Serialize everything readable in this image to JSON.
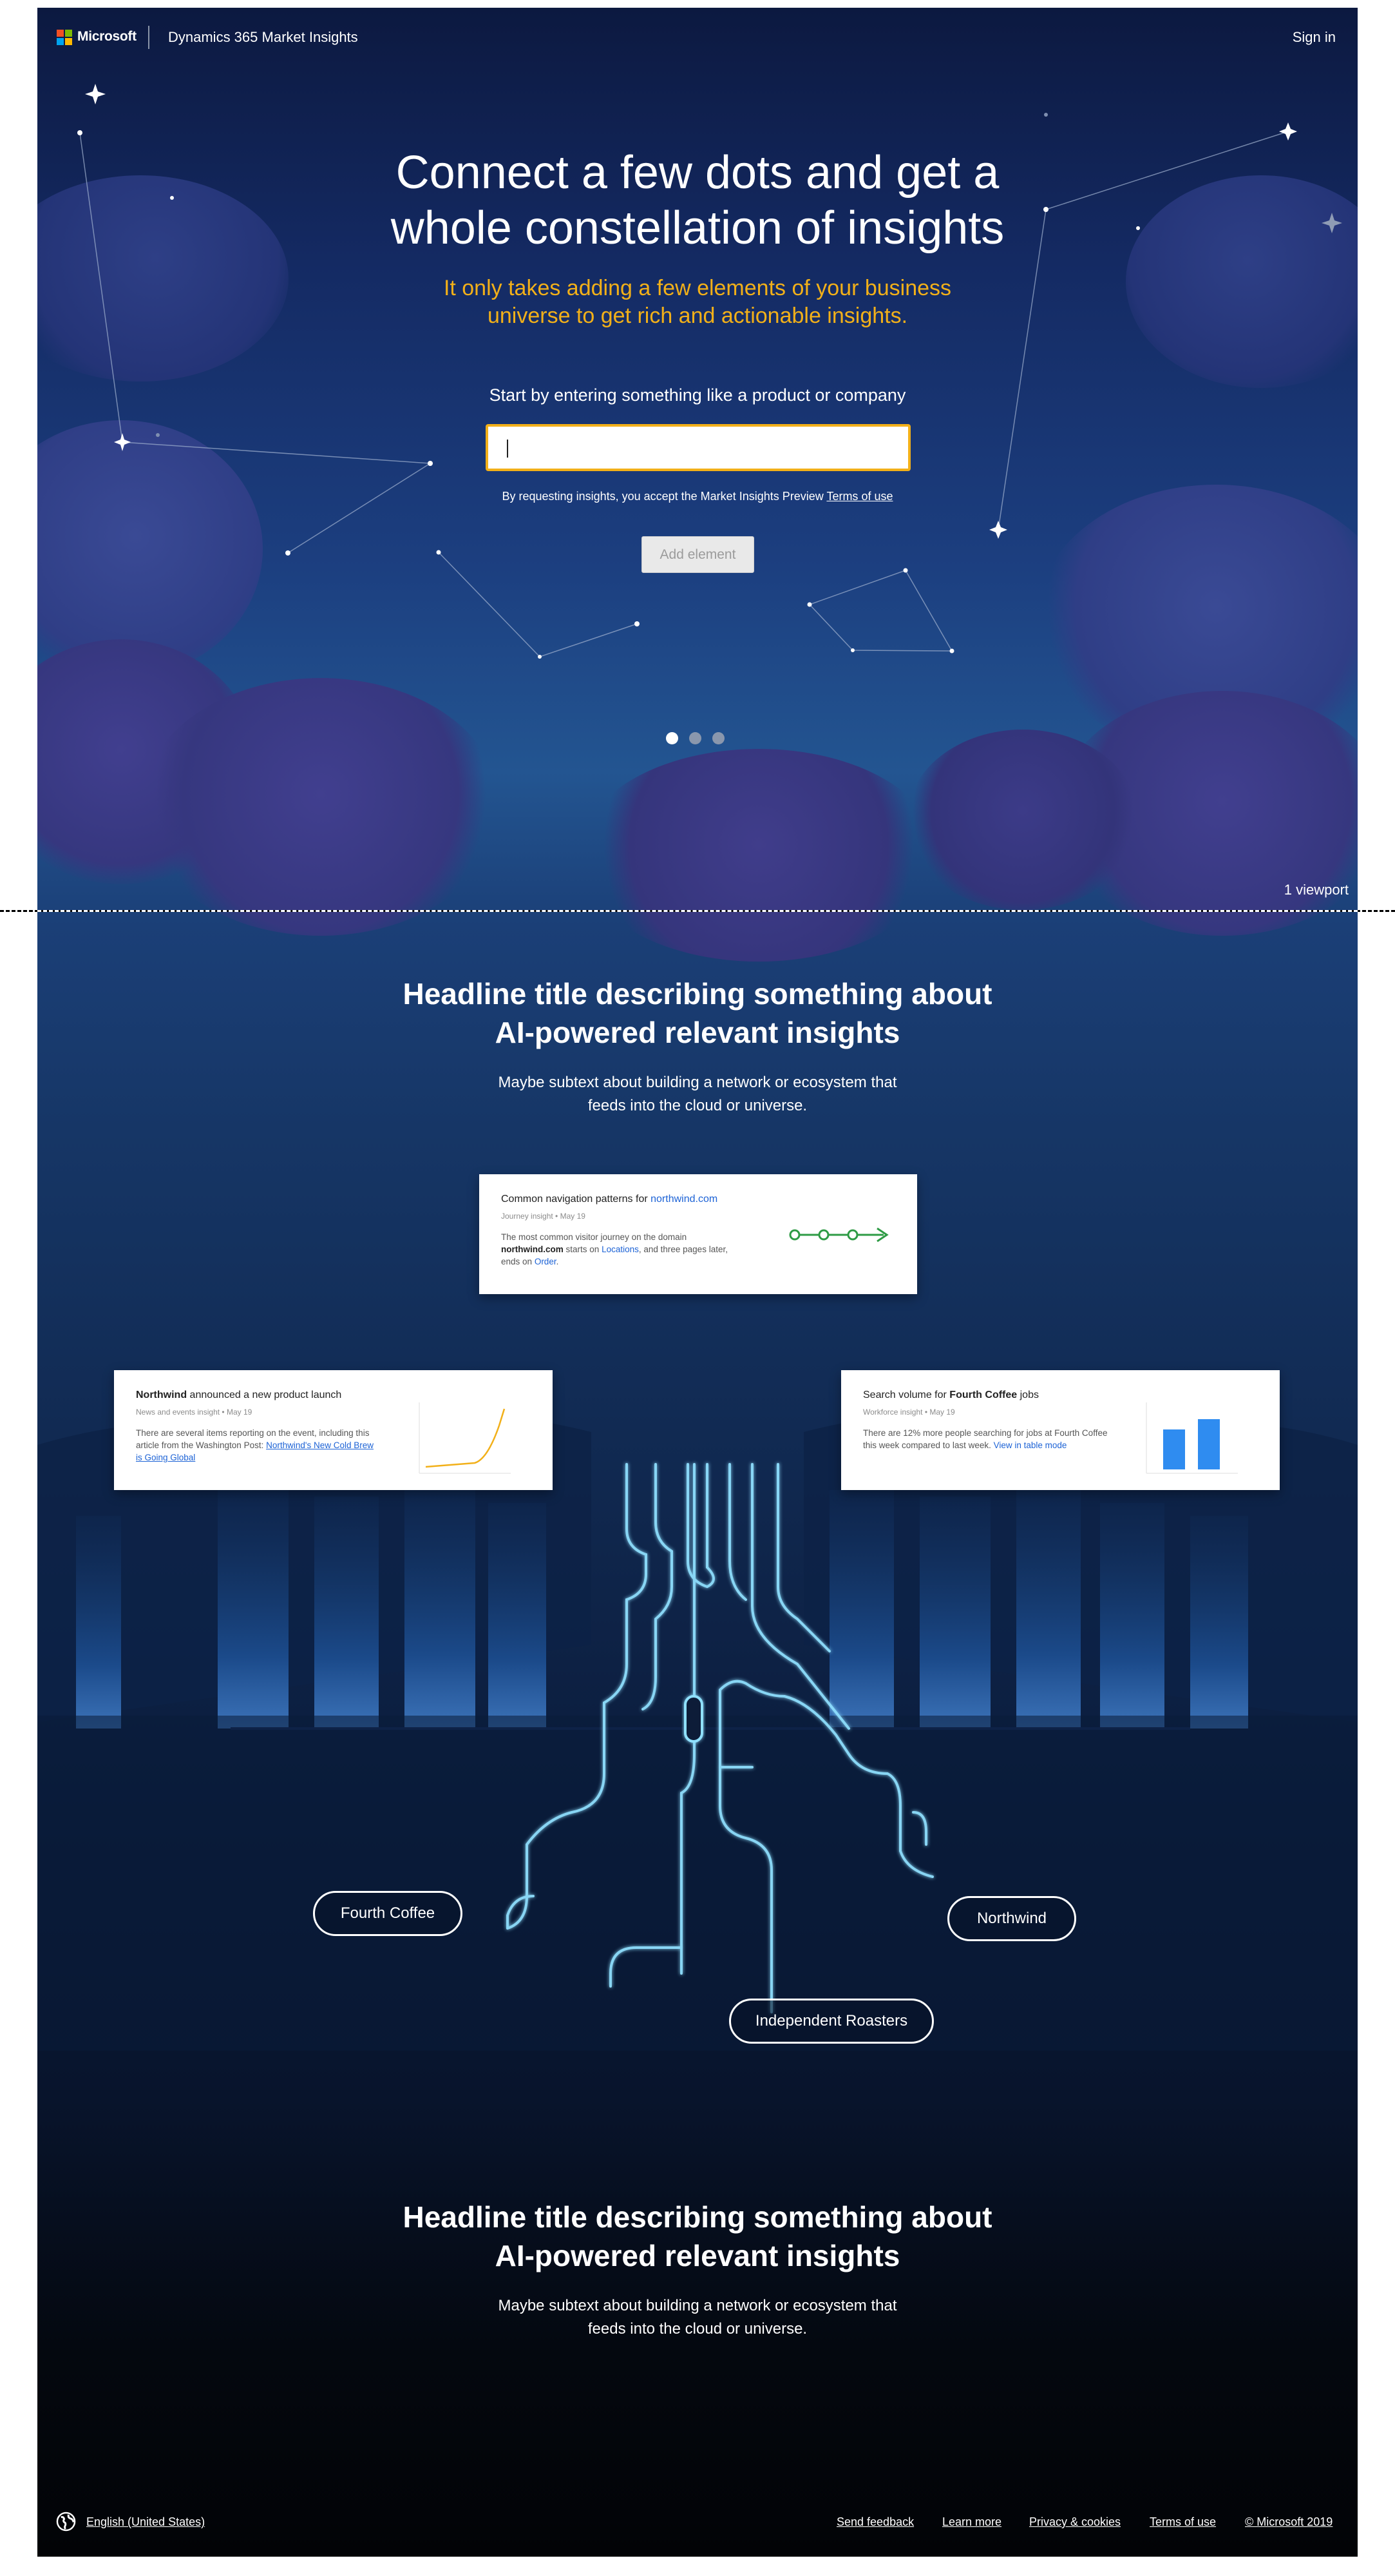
{
  "header": {
    "brand": "Microsoft",
    "product": "Dynamics 365 Market Insights",
    "sign_in": "Sign in",
    "logo_colors": [
      "#f25022",
      "#7fba00",
      "#00a4ef",
      "#ffb900"
    ]
  },
  "hero": {
    "title_line1": "Connect a few dots and get a",
    "title_line2": "whole constellation of insights",
    "subtitle_line1": "It only takes adding a few elements of your business",
    "subtitle_line2": "universe to get rich and actionable insights.",
    "prompt": "Start by entering something like a product or company",
    "input_value": "",
    "terms_prefix": "By requesting insights, you accept the Market Insights Preview",
    "terms_link": "Terms of use",
    "add_button": "Add element",
    "carousel": {
      "pages": 3,
      "active": 1
    }
  },
  "viewport_label": "1 viewport",
  "section2": {
    "title_line1": "Headline title describing something about",
    "title_line2": "AI-powered relevant insights",
    "subtitle_line1": "Maybe subtext about building a network or ecosystem that",
    "subtitle_line2": "feeds into the cloud or universe."
  },
  "cards": {
    "navigation": {
      "title_prefix": "Common navigation patterns for",
      "title_link": "northwind.com",
      "meta_type": "Journey insight",
      "meta_date": "May 19",
      "body_1": "The most common visitor journey on the domain",
      "body_domain": "northwind.com",
      "body_2": "starts on",
      "body_link1": "Locations",
      "body_3": ", and three pages later, ends on",
      "body_link2": "Order",
      "body_4": "."
    },
    "news": {
      "title_bold": "Northwind",
      "title_rest": "announced a new product launch",
      "meta_type": "News and events insight",
      "meta_date": "May 19",
      "body_1": "There are several items reporting on the event, including this article from the Washington Post:",
      "body_link": "Northwind's New Cold Brew is Going Global"
    },
    "search": {
      "title_prefix": "Search volume for",
      "title_bold": "Fourth Coffee",
      "title_suffix": "jobs",
      "meta_type": "Workforce insight",
      "meta_date": "May 19",
      "body_1": "There are 12% more people searching for jobs at Fourth Coffee this week compared to last week.",
      "body_link": "View in table mode"
    }
  },
  "entities": {
    "left": "Fourth Coffee",
    "right": "Northwind",
    "bottom": "Independent Roasters"
  },
  "section3": {
    "title_line1": "Headline title describing something about",
    "title_line2": "AI-powered relevant insights",
    "subtitle_line1": "Maybe subtext about building a network or ecosystem that",
    "subtitle_line2": "feeds into the cloud or universe."
  },
  "footer": {
    "locale": "English (United States)",
    "links": [
      "Send feedback",
      "Learn more",
      "Privacy & cookies",
      "Terms of use",
      "© Microsoft 2019"
    ]
  },
  "colors": {
    "accent": "#f2b019",
    "link": "#1d63d6",
    "chart_line": "#f2b019",
    "chart_bar": "#2f8cf0",
    "journey_green": "#2e9b45",
    "circuit_glow": "#7fd3ff"
  }
}
